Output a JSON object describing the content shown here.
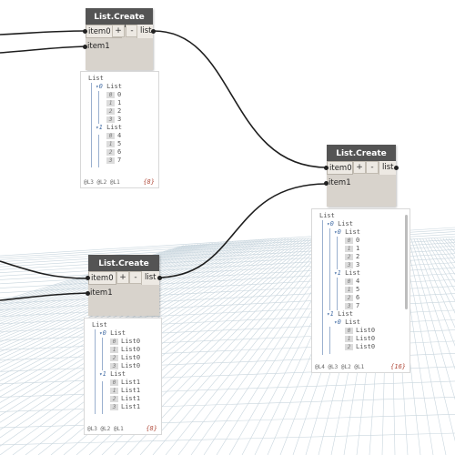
{
  "wires_color": "#1e1e1e",
  "grid_color": "#c9d6de",
  "nodes": [
    {
      "title": "List.Create",
      "inputs": [
        "item0",
        "item1"
      ],
      "output": "list",
      "add_label": "+",
      "remove_label": "-",
      "preview": {
        "lines": [
          {
            "kind": "root",
            "text": "List"
          },
          {
            "kind": "sub",
            "level": "0",
            "text": "List"
          },
          {
            "kind": "item",
            "idx": "0",
            "value": "0"
          },
          {
            "kind": "item",
            "idx": "1",
            "value": "1"
          },
          {
            "kind": "item",
            "idx": "2",
            "value": "2"
          },
          {
            "kind": "item",
            "idx": "3",
            "value": "3"
          },
          {
            "kind": "sub",
            "level": "1",
            "text": "List"
          },
          {
            "kind": "item",
            "idx": "0",
            "value": "4"
          },
          {
            "kind": "item",
            "idx": "1",
            "value": "5"
          },
          {
            "kind": "item",
            "idx": "2",
            "value": "6"
          },
          {
            "kind": "item",
            "idx": "3",
            "value": "7"
          }
        ],
        "footer": "@L3 @L2 @L1",
        "count": "{8}"
      }
    },
    {
      "title": "List.Create",
      "inputs": [
        "item0",
        "item1"
      ],
      "output": "list",
      "add_label": "+",
      "remove_label": "-",
      "preview": {
        "lines": [
          {
            "kind": "root",
            "text": "List"
          },
          {
            "kind": "sub",
            "level": "0",
            "text": "List"
          },
          {
            "kind": "item",
            "idx": "0",
            "value": "List0"
          },
          {
            "kind": "item",
            "idx": "1",
            "value": "List0"
          },
          {
            "kind": "item",
            "idx": "2",
            "value": "List0"
          },
          {
            "kind": "item",
            "idx": "3",
            "value": "List0"
          },
          {
            "kind": "sub",
            "level": "1",
            "text": "List"
          },
          {
            "kind": "item",
            "idx": "0",
            "value": "List1"
          },
          {
            "kind": "item",
            "idx": "1",
            "value": "List1"
          },
          {
            "kind": "item",
            "idx": "2",
            "value": "List1"
          },
          {
            "kind": "item",
            "idx": "3",
            "value": "List1"
          }
        ],
        "footer": "@L3 @L2 @L1",
        "count": "{8}"
      }
    },
    {
      "title": "List.Create",
      "inputs": [
        "item0",
        "item1"
      ],
      "output": "list",
      "add_label": "+",
      "remove_label": "-",
      "preview": {
        "lines": [
          {
            "kind": "root",
            "text": "List"
          },
          {
            "kind": "sub",
            "level": "0",
            "text": "List"
          },
          {
            "kind": "sub2",
            "level": "0",
            "text": "List"
          },
          {
            "kind": "item2",
            "idx": "0",
            "value": "0"
          },
          {
            "kind": "item2",
            "idx": "1",
            "value": "1"
          },
          {
            "kind": "item2",
            "idx": "2",
            "value": "2"
          },
          {
            "kind": "item2",
            "idx": "3",
            "value": "3"
          },
          {
            "kind": "sub2",
            "level": "1",
            "text": "List"
          },
          {
            "kind": "item2",
            "idx": "0",
            "value": "4"
          },
          {
            "kind": "item2",
            "idx": "1",
            "value": "5"
          },
          {
            "kind": "item2",
            "idx": "2",
            "value": "6"
          },
          {
            "kind": "item2",
            "idx": "3",
            "value": "7"
          },
          {
            "kind": "sub",
            "level": "1",
            "text": "List"
          },
          {
            "kind": "sub2",
            "level": "0",
            "text": "List"
          },
          {
            "kind": "item2",
            "idx": "0",
            "value": "List0"
          },
          {
            "kind": "item2",
            "idx": "1",
            "value": "List0"
          },
          {
            "kind": "item2",
            "idx": "2",
            "value": "List0"
          }
        ],
        "footer": "@L4 @L3 @L2 @L1",
        "count": "{16}"
      }
    }
  ]
}
